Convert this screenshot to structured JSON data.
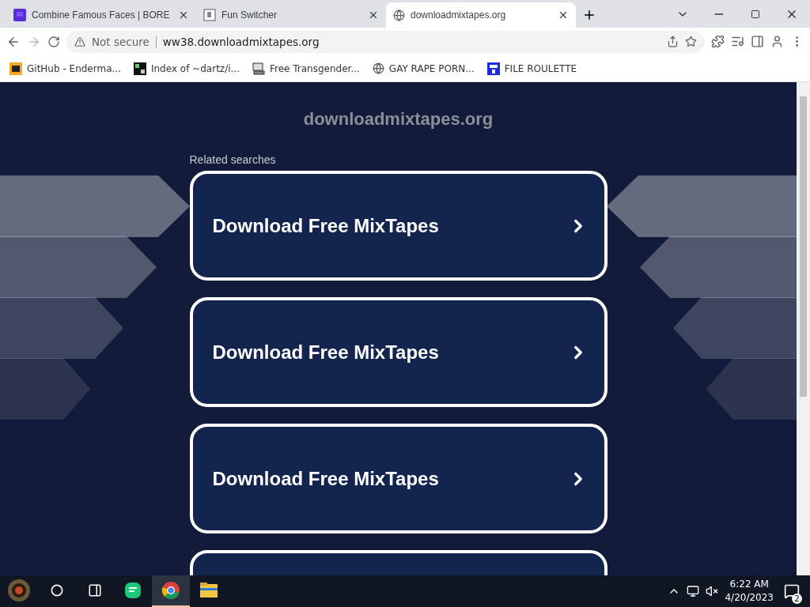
{
  "tabs": [
    {
      "title": "Combine Famous Faces | BORE",
      "selected": false
    },
    {
      "title": "Fun Switcher",
      "selected": false
    },
    {
      "title": "downloadmixtapes.org",
      "selected": true
    }
  ],
  "address_bar": {
    "security": "Not secure",
    "url": "ww38.downloadmixtapes.org"
  },
  "bookmarks": [
    {
      "label": "GitHub - Enderma..."
    },
    {
      "label": "Index of ~dartz/i..."
    },
    {
      "label": "Free Transgender..."
    },
    {
      "label": "GAY RAPE PORN..."
    },
    {
      "label": "FILE ROULETTE"
    }
  ],
  "page": {
    "site_name": "downloadmixtapes.org",
    "section_title": "Related searches",
    "results": [
      {
        "title": "Download Free MixTapes"
      },
      {
        "title": "Download Free MixTapes"
      },
      {
        "title": "Download Free MixTapes"
      }
    ],
    "more_results_below": true
  },
  "taskbar": {
    "apps": [
      {
        "kind": "start"
      },
      {
        "kind": "search"
      },
      {
        "kind": "taskview"
      },
      {
        "kind": "chat"
      },
      {
        "kind": "chrome",
        "selected": true
      },
      {
        "kind": "files",
        "selected": false
      }
    ],
    "time": "6:22 AM",
    "date": "4/20/2023",
    "notifications": "2"
  }
}
